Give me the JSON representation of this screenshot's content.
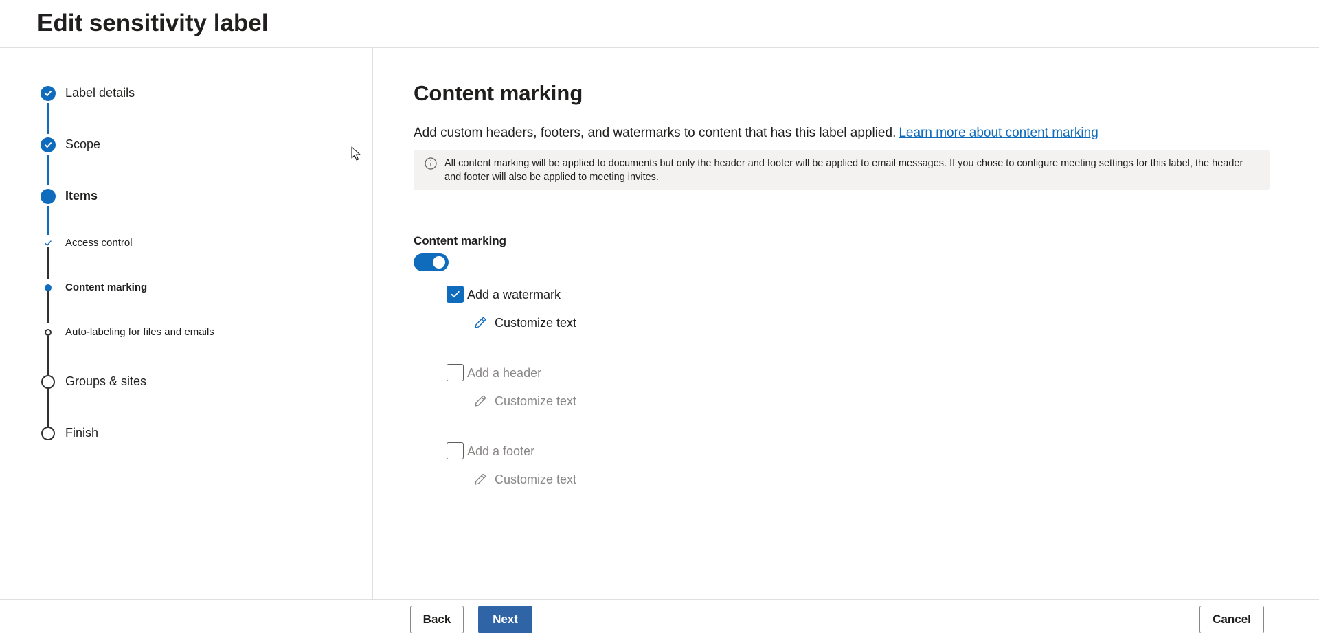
{
  "page": {
    "title": "Edit sensitivity label"
  },
  "stepper": {
    "steps": [
      {
        "label": "Label details",
        "state": "completed"
      },
      {
        "label": "Scope",
        "state": "completed"
      },
      {
        "label": "Items",
        "state": "current"
      },
      {
        "label": "Access control",
        "state": "completed",
        "sub": true
      },
      {
        "label": "Content marking",
        "state": "current",
        "sub": true
      },
      {
        "label": "Auto-labeling for files and emails",
        "state": "pending",
        "sub": true
      },
      {
        "label": "Groups & sites",
        "state": "pending"
      },
      {
        "label": "Finish",
        "state": "pending"
      }
    ]
  },
  "main": {
    "title": "Content marking",
    "description": "Add custom headers, footers, and watermarks to content that has this label applied.",
    "learn_more": "Learn more about content marking",
    "info": "All content marking will be applied to documents but only the header and footer will be applied to email messages. If you chose to configure meeting settings for this label, the header and footer will also be applied to meeting invites.",
    "toggle_label": "Content marking",
    "toggle_on": true,
    "options": [
      {
        "label": "Add a watermark",
        "checked": true,
        "customize": "Customize text"
      },
      {
        "label": "Add a header",
        "checked": false,
        "customize": "Customize text"
      },
      {
        "label": "Add a footer",
        "checked": false,
        "customize": "Customize text"
      }
    ]
  },
  "footer": {
    "back": "Back",
    "next": "Next",
    "cancel": "Cancel"
  },
  "colors": {
    "accent": "#0f6cbd",
    "primary_button": "#2f65a6",
    "disabled_text": "#8a8886"
  }
}
